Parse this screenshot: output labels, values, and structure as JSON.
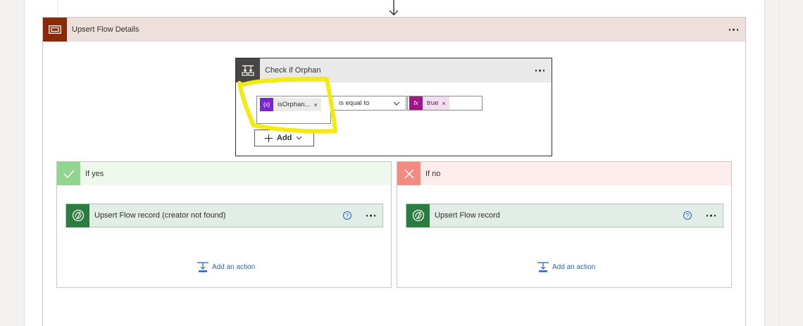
{
  "scope": {
    "title": "Upsert Flow Details"
  },
  "condition": {
    "title": "Check if Orphan",
    "left_token": {
      "label": "isOrphan...",
      "icon_text": "{x}",
      "close": "×"
    },
    "operator": {
      "selected": "is equal to"
    },
    "right_token": {
      "label": "true",
      "icon_text": "fx",
      "close": "×"
    },
    "add_label": "Add"
  },
  "branch_yes": {
    "title": "If yes",
    "action_title": "Upsert Flow record (creator not found)",
    "add_action_label": "Add an action"
  },
  "branch_no": {
    "title": "If no",
    "action_title": "Upsert Flow record",
    "add_action_label": "Add an action"
  },
  "colors": {
    "scope_accent": "#8b2a09",
    "condition_accent": "#484644",
    "yes_accent": "#92d591",
    "no_accent": "#f28b82",
    "dataverse_green": "#2b7d3f",
    "variable_purple": "#7c25d6",
    "expression_magenta": "#a1148c",
    "highlight_yellow": "#f5ea10",
    "link_blue": "#2563c7"
  },
  "icons": {
    "scope": "scope-icon",
    "condition": "condition-icon",
    "yes": "checkmark-icon",
    "no": "cross-icon",
    "action": "dataverse-icon",
    "help": "help-icon",
    "add_action": "add-action-icon"
  }
}
